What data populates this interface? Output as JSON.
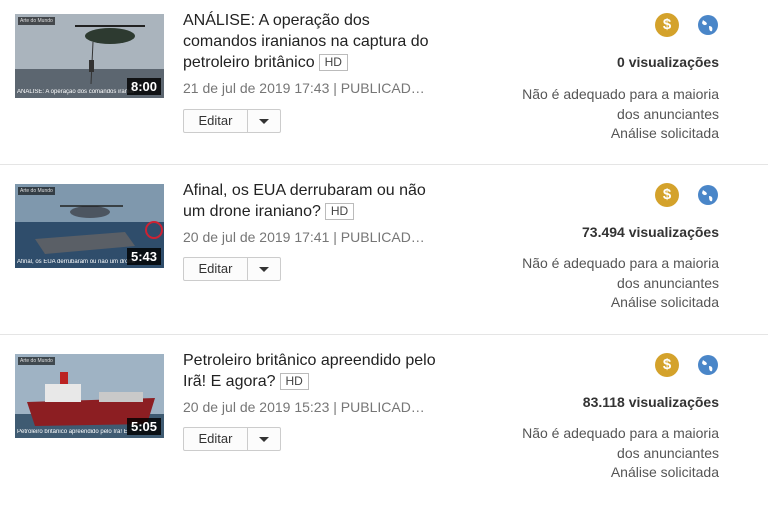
{
  "videos": [
    {
      "duration": "8:00",
      "thumb_caption": "ANÁLISE: A operação dos comandos iranianos na captura do petroleiro",
      "title": "ANÁLISE: A operação dos comandos iranianos na captura do petroleiro britânico",
      "badge": "HD",
      "date": "21 de jul de 2019 17:43",
      "status": "PUBLICAD…",
      "edit_label": "Editar",
      "views": "0 visualizações",
      "ad_line1": "Não é adequado para a maioria",
      "ad_line2": "dos anunciantes",
      "ad_line3": "Análise solicitada",
      "monetization_icon": "dollar-icon",
      "visibility_icon": "globe-icon"
    },
    {
      "duration": "5:43",
      "thumb_caption": "Afinal, os EUA derrubaram ou não um drone iraniano",
      "title": "Afinal, os EUA derrubaram ou não um drone iraniano?",
      "badge": "HD",
      "date": "20 de jul de 2019 17:41",
      "status": "PUBLICAD…",
      "edit_label": "Editar",
      "views": "73.494 visualizações",
      "ad_line1": "Não é adequado para a maioria",
      "ad_line2": "dos anunciantes",
      "ad_line3": "Análise solicitada",
      "monetization_icon": "dollar-icon",
      "visibility_icon": "globe-icon"
    },
    {
      "duration": "5:05",
      "thumb_caption": "Petroleiro britânico apreendido pelo Irã! E",
      "title": "Petroleiro britânico apreendido pelo Irã! E agora?",
      "badge": "HD",
      "date": "20 de jul de 2019 15:23",
      "status": "PUBLICAD…",
      "edit_label": "Editar",
      "views": "83.118 visualizações",
      "ad_line1": "Não é adequado para a maioria",
      "ad_line2": "dos anunciantes",
      "ad_line3": "Análise solicitada",
      "monetization_icon": "dollar-icon",
      "visibility_icon": "globe-icon"
    }
  ],
  "colors": {
    "monetization": "#d4a22b",
    "globe": "#4a86c8",
    "separator": "#e5e5e5"
  }
}
